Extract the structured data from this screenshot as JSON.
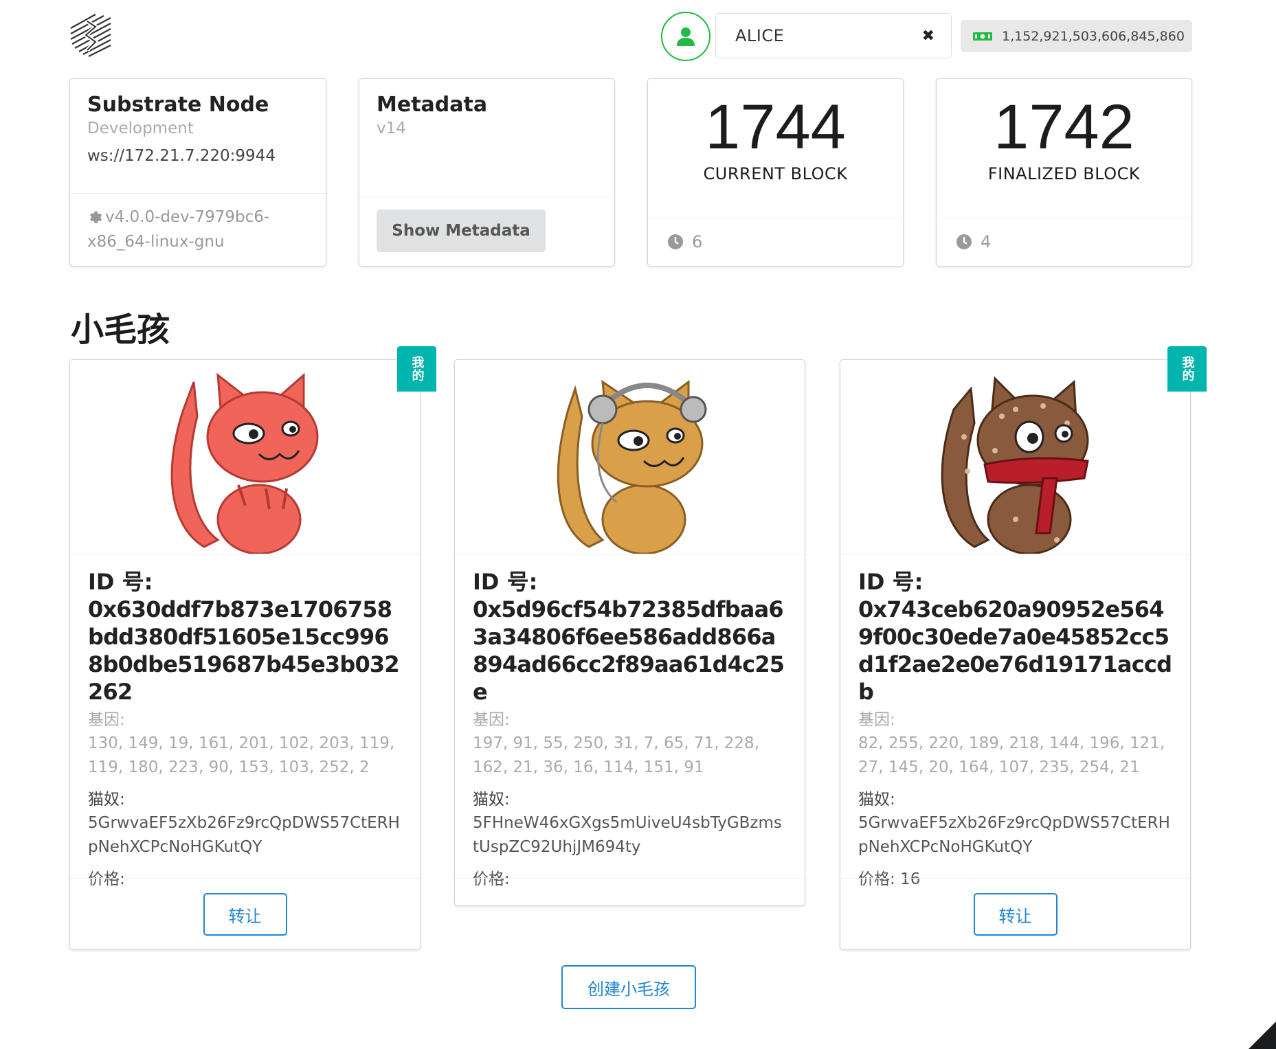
{
  "header": {
    "account": "ALICE",
    "balance": "1,152,921,503,606,845,860",
    "clear_icon": "close-icon"
  },
  "node_info": {
    "title": "Substrate Node",
    "chain": "Development",
    "endpoint": "ws://172.21.7.220:9944",
    "version": "v4.0.0-dev-7979bc6-x86_64-linux-gnu"
  },
  "metadata": {
    "title": "Metadata",
    "version": "v14",
    "button": "Show Metadata"
  },
  "current_block": {
    "value": "1744",
    "label": "CURRENT BLOCK",
    "timer": "6"
  },
  "finalized_block": {
    "value": "1742",
    "label": "FINALIZED BLOCK",
    "timer": "4"
  },
  "section": {
    "title": "小毛孩"
  },
  "kitties": [
    {
      "ribbon": "我的",
      "id_label": "ID 号:",
      "id": "0x630ddf7b873e1706758bdd380df51605e15cc9968b0dbe519687b45e3b032262",
      "gene_label": "基因:",
      "genes": "130, 149, 19, 161, 201, 102, 203, 119, 119, 180, 223, 90, 153, 103, 252, 2",
      "owner_label": "猫奴:",
      "owner": "5GrwvaEF5zXb26Fz9rcQpDWS57CtERHpNehXCPcNoHGKutQY",
      "price_label": "价格:",
      "price": "",
      "button": "转让",
      "color": "#f0645a"
    },
    {
      "ribbon": "",
      "id_label": "ID 号:",
      "id": "0x5d96cf54b72385dfbaa63a34806f6ee586add866a894ad66cc2f89aa61d4c25e",
      "gene_label": "基因:",
      "genes": "197, 91, 55, 250, 31, 7, 65, 71, 228, 162, 21, 36, 16, 114, 151, 91",
      "owner_label": "猫奴:",
      "owner": "5FHneW46xGXgs5mUiveU4sbTyGBzmstUspZC92UhjJM694ty",
      "price_label": "价格:",
      "price": "",
      "button": "",
      "color": "#d9a049"
    },
    {
      "ribbon": "我的",
      "id_label": "ID 号:",
      "id": "0x743ceb620a90952e5649f00c30ede7a0e45852cc5d1f2ae2e0e76d19171accdb",
      "gene_label": "基因:",
      "genes": "82, 255, 220, 189, 218, 144, 196, 121, 27, 145, 20, 164, 107, 235, 254, 21",
      "owner_label": "猫奴:",
      "owner": "5GrwvaEF5zXb26Fz9rcQpDWS57CtERHpNehXCPcNoHGKutQY",
      "price_label": "价格:",
      "price": "16",
      "button": "转让",
      "color": "#8a5a3c"
    }
  ],
  "create_button": "创建小毛孩",
  "colors": {
    "accent_blue": "#2185d0",
    "teal": "#00b5ad",
    "green": "#21ba45"
  }
}
